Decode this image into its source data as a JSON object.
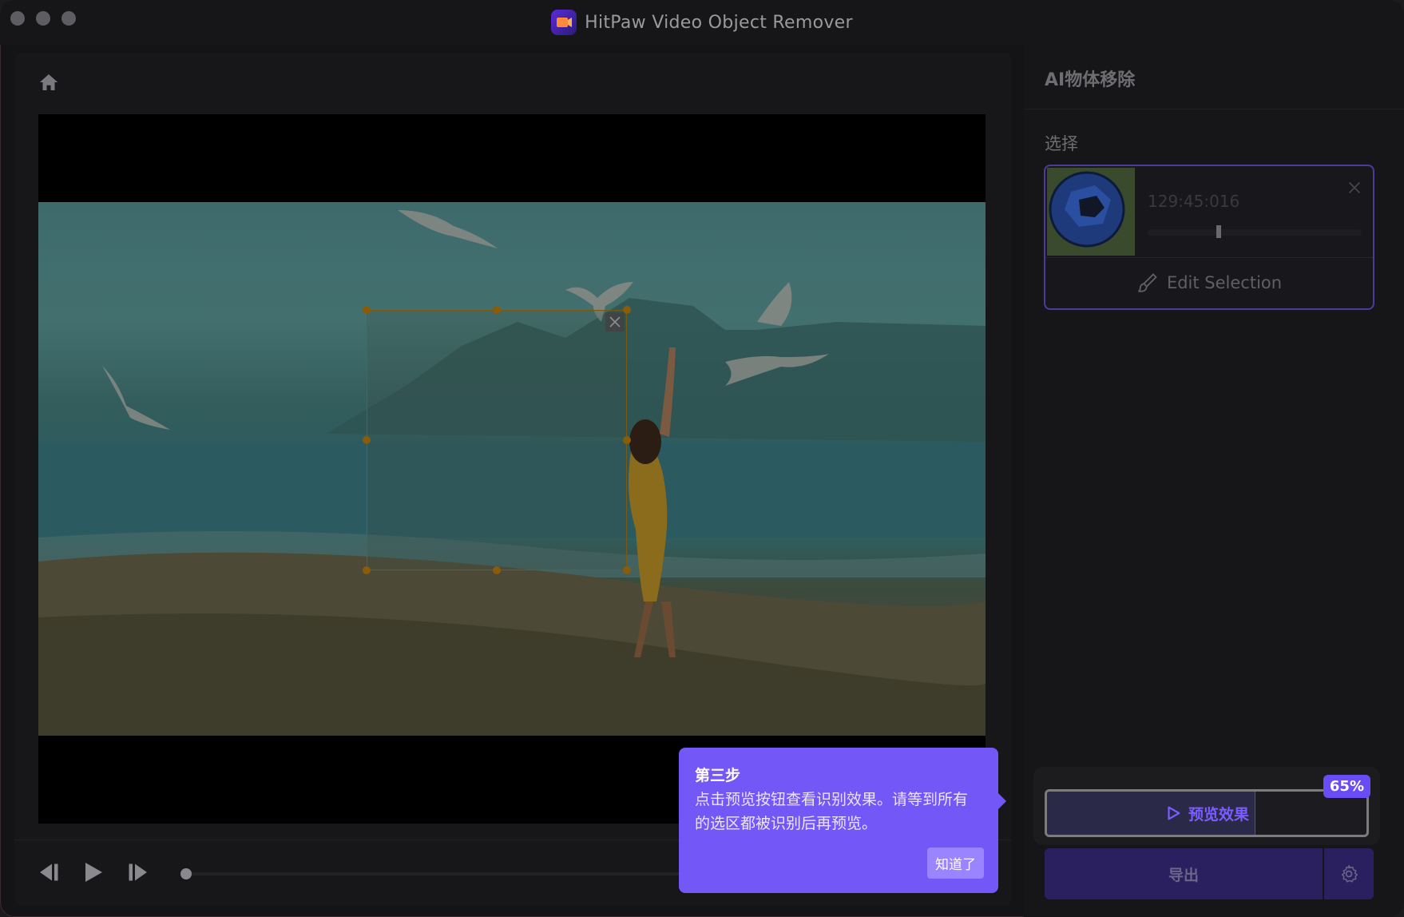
{
  "app": {
    "title": "HitPaw Video Object Remover"
  },
  "left": {
    "home_icon": "home-icon",
    "controls": {
      "prev_icon": "prev-frame-icon",
      "play_icon": "play-icon",
      "next_icon": "next-frame-icon"
    }
  },
  "right": {
    "panel_title": "AI物体移除",
    "section_label": "选择",
    "object": {
      "time": "129:45:016",
      "edit_label": "Edit Selection",
      "close_icon": "close-icon",
      "brush_icon": "brush-icon"
    },
    "preview": {
      "label": "预览效果",
      "percent_label": "65%",
      "progress": 0.65
    },
    "export": {
      "label": "导出",
      "settings_icon": "gear-icon"
    }
  },
  "tooltip": {
    "title": "第三步",
    "body": "点击预览按钮查看识别效果。请等到所有的选区都被识别后再预览。",
    "button": "知道了"
  },
  "colors": {
    "accent": "#7457f7",
    "export_bg": "#2a2060"
  }
}
